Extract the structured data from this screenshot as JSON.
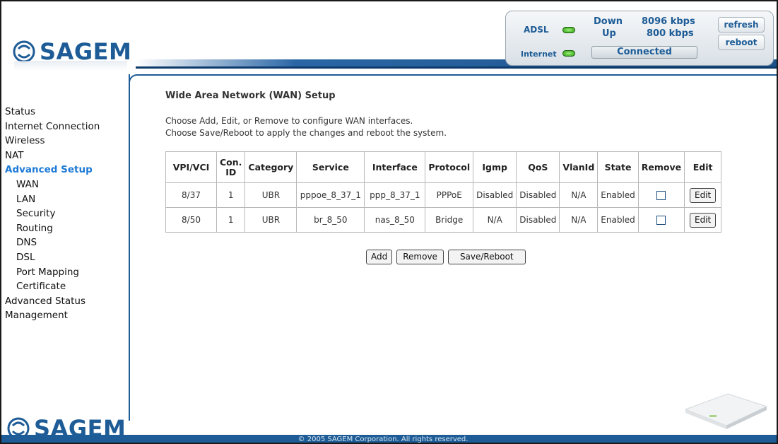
{
  "brand": {
    "name": "SAGEM"
  },
  "status": {
    "adsl_label": "ADSL",
    "internet_label": "Internet",
    "down_label": "Down",
    "up_label": "Up",
    "down_rate": "8096 kbps",
    "up_rate": "800 kbps",
    "connection_state": "Connected",
    "led_color": "#3fbf1f",
    "refresh_label": "refresh",
    "reboot_label": "reboot"
  },
  "sidebar": {
    "items": [
      {
        "label": "Status",
        "active": false,
        "sub": false
      },
      {
        "label": "Internet Connection",
        "active": false,
        "sub": false
      },
      {
        "label": "Wireless",
        "active": false,
        "sub": false
      },
      {
        "label": "NAT",
        "active": false,
        "sub": false
      },
      {
        "label": "Advanced Setup",
        "active": true,
        "sub": false
      },
      {
        "label": "WAN",
        "active": false,
        "sub": true
      },
      {
        "label": "LAN",
        "active": false,
        "sub": true
      },
      {
        "label": "Security",
        "active": false,
        "sub": true
      },
      {
        "label": "Routing",
        "active": false,
        "sub": true
      },
      {
        "label": "DNS",
        "active": false,
        "sub": true
      },
      {
        "label": "DSL",
        "active": false,
        "sub": true
      },
      {
        "label": "Port Mapping",
        "active": false,
        "sub": true
      },
      {
        "label": "Certificate",
        "active": false,
        "sub": true
      },
      {
        "label": "Advanced Status",
        "active": false,
        "sub": false
      },
      {
        "label": "Management",
        "active": false,
        "sub": false
      }
    ]
  },
  "main": {
    "title": "Wide Area Network (WAN) Setup",
    "desc_line1": "Choose Add, Edit, or Remove to configure WAN interfaces.",
    "desc_line2": "Choose Save/Reboot to apply the changes and reboot the system.",
    "columns": [
      "VPI/VCI",
      "Con. ID",
      "Category",
      "Service",
      "Interface",
      "Protocol",
      "Igmp",
      "QoS",
      "VlanId",
      "State",
      "Remove",
      "Edit"
    ],
    "rows": [
      {
        "vpi_vci": "8/37",
        "con_id": "1",
        "category": "UBR",
        "service": "pppoe_8_37_1",
        "interface": "ppp_8_37_1",
        "protocol": "PPPoE",
        "igmp": "Disabled",
        "qos": "Disabled",
        "vlanid": "N/A",
        "state": "Enabled",
        "remove_checked": false,
        "edit_label": "Edit"
      },
      {
        "vpi_vci": "8/50",
        "con_id": "1",
        "category": "UBR",
        "service": "br_8_50",
        "interface": "nas_8_50",
        "protocol": "Bridge",
        "igmp": "N/A",
        "qos": "Disabled",
        "vlanid": "N/A",
        "state": "Enabled",
        "remove_checked": false,
        "edit_label": "Edit"
      }
    ],
    "buttons": {
      "add": "Add",
      "remove": "Remove",
      "save_reboot": "Save/Reboot"
    }
  },
  "footer": {
    "copyright": "© 2005 SAGEM Corporation. All rights reserved."
  },
  "colors": {
    "brand_blue": "#1d5c96",
    "active_nav": "#1d7ad6"
  }
}
